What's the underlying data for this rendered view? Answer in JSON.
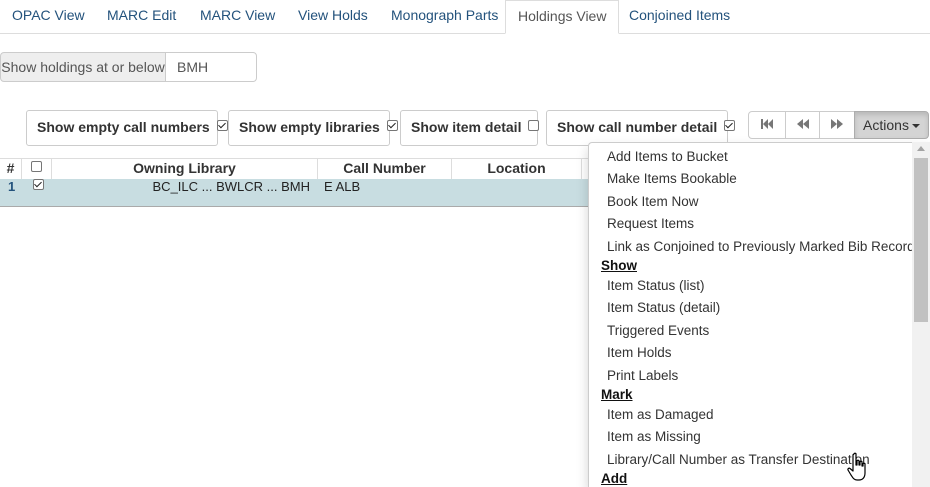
{
  "tabs": [
    {
      "label": "OPAC View"
    },
    {
      "label": "MARC Edit"
    },
    {
      "label": "MARC View"
    },
    {
      "label": "View Holds"
    },
    {
      "label": "Monograph Parts"
    },
    {
      "label": "Holdings View",
      "active": true
    },
    {
      "label": "Conjoined Items"
    }
  ],
  "filter": {
    "label": "Show holdings at or below",
    "value": "BMH"
  },
  "toggles": {
    "empty_call_numbers": {
      "label": "Show empty call numbers",
      "checked": true
    },
    "empty_libraries": {
      "label": "Show empty libraries",
      "checked": true
    },
    "item_detail": {
      "label": "Show item detail",
      "checked": false
    },
    "call_number_detail": {
      "label": "Show call number detail",
      "checked": true
    }
  },
  "actions": {
    "label": "Actions"
  },
  "grid": {
    "headers": [
      "#",
      "",
      "Owning Library",
      "Call Number",
      "Location"
    ],
    "rows": [
      {
        "index": "1",
        "checked": true,
        "owning_library": "BC_ILC ... BWLCR ... BMH",
        "call_number": "E ALB",
        "location": ""
      }
    ]
  },
  "menu": {
    "items_top": [
      "Add Items to Bucket",
      "Make Items Bookable",
      "Book Item Now",
      "Request Items",
      "Link as Conjoined to Previously Marked Bib Record"
    ],
    "show_header": "Show",
    "show_items": [
      "Item Status (list)",
      "Item Status (detail)",
      "Triggered Events",
      "Item Holds",
      "Print Labels"
    ],
    "mark_header": "Mark",
    "mark_items": [
      "Item as Damaged",
      "Item as Missing",
      "Library/Call Number as Transfer Destination"
    ],
    "add_header": "Add"
  },
  "colors": {
    "link": "#23527c",
    "row_selected": "#c8dde1",
    "actions_active": "#d4d4d4"
  }
}
